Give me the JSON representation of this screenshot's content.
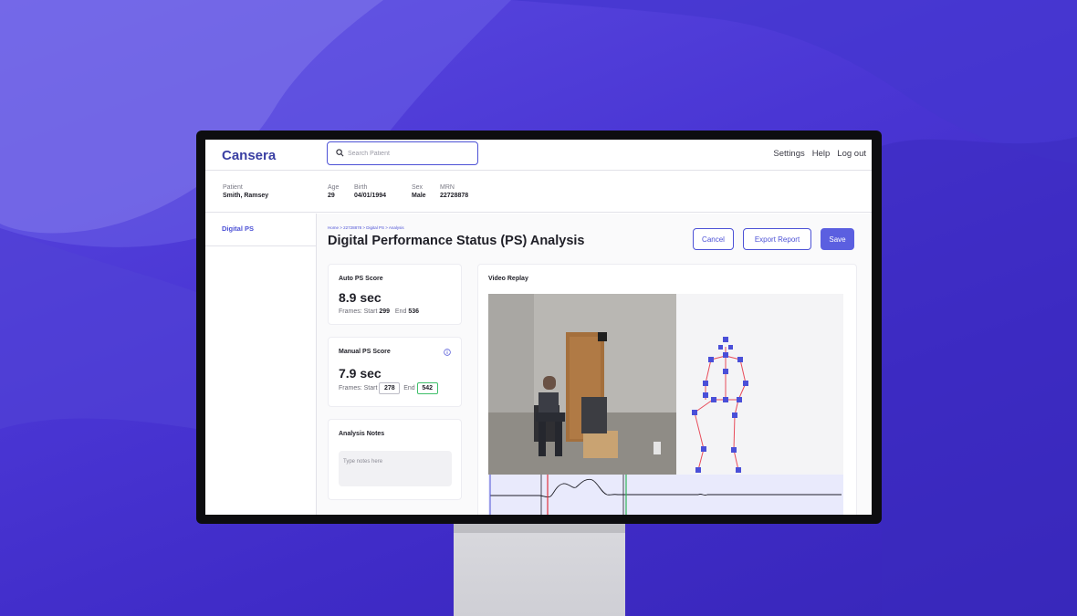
{
  "app": {
    "brand": "Cansera"
  },
  "search": {
    "placeholder": "Search Patient"
  },
  "nav": {
    "settings": "Settings",
    "help": "Help",
    "logout": "Log out"
  },
  "patient": {
    "patient_label": "Patient",
    "patient_value": "Smith, Ramsey",
    "age_label": "Age",
    "age_value": "29",
    "birth_label": "Birth",
    "birth_value": "04/01/1994",
    "sex_label": "Sex",
    "sex_value": "Male",
    "mrn_label": "MRN",
    "mrn_value": "22728878"
  },
  "sidebar": {
    "items": [
      {
        "label": "Digital PS"
      }
    ]
  },
  "page": {
    "breadcrumb": "Home > 22728878 > Digital PS > Analysis",
    "title": "Digital Performance Status (PS) Analysis"
  },
  "actions": {
    "cancel": "Cancel",
    "export": "Export Report",
    "save": "Save"
  },
  "auto_ps": {
    "title": "Auto PS Score",
    "score": "8.9 sec",
    "frames_label": "Frames: Start",
    "start": "299",
    "end_label": "End",
    "end": "536"
  },
  "manual_ps": {
    "title": "Manual PS Score",
    "score": "7.9 sec",
    "frames_label": "Frames: Start",
    "start": "278",
    "end_label": "End",
    "end": "542"
  },
  "notes": {
    "title": "Analysis Notes",
    "placeholder": "Type notes here"
  },
  "video": {
    "title": "Video Replay"
  },
  "colors": {
    "accent": "#4d52d6",
    "start_marker": "#e0313a",
    "end_marker": "#2fb35a",
    "skeleton_joint": "#4a4fd8",
    "skeleton_bone": "#e84b5a"
  }
}
